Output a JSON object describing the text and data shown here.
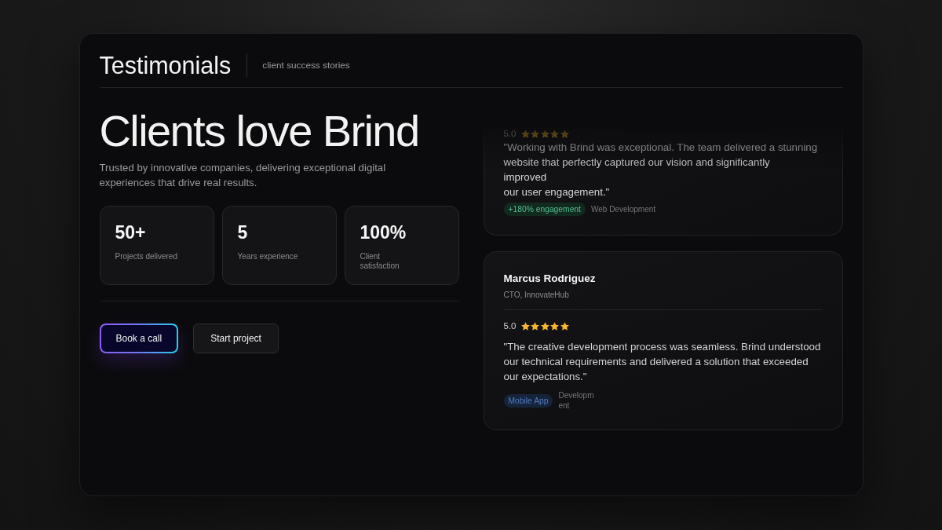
{
  "header": {
    "title": "Testimonials",
    "subtitle": "client success stories"
  },
  "hero": {
    "headline": "Clients love Brind",
    "description": "Trusted by innovative companies, delivering exceptional digital experiences that drive real results."
  },
  "stats": [
    {
      "value": "50+",
      "label": "Projects delivered"
    },
    {
      "value": "5",
      "label": "Years experience"
    },
    {
      "value": "100%",
      "label": "Client\nsatisfaction"
    }
  ],
  "buttons": [
    {
      "label": "Book a call",
      "kind": "primary"
    },
    {
      "label": "Start project",
      "kind": "secondary"
    }
  ],
  "testimonials": [
    {
      "rating": "5.0",
      "stars": 5,
      "quote": "\"Working with Brind was exceptional. The team delivered a stunning website that perfectly captured our vision and significantly\nimproved\nour user engagement.\"",
      "tags": [
        {
          "label": "+180% engagement",
          "kind": "highlight",
          "color": "#12291f"
        },
        {
          "label": "Web Development",
          "kind": "plain"
        }
      ]
    },
    {
      "name": "Marcus Rodriguez",
      "role": "CTO, InnovateHub",
      "rating": "5.0",
      "stars": 5,
      "quote": "\"The creative development process was seamless. Brind understood our technical requirements and delivered a solution that exceeded our expectations.\"",
      "tags": [
        {
          "label": "Mobile App",
          "kind": "highlight",
          "color": "#15233b"
        },
        {
          "label": "Development",
          "kind": "narrow"
        }
      ]
    }
  ]
}
